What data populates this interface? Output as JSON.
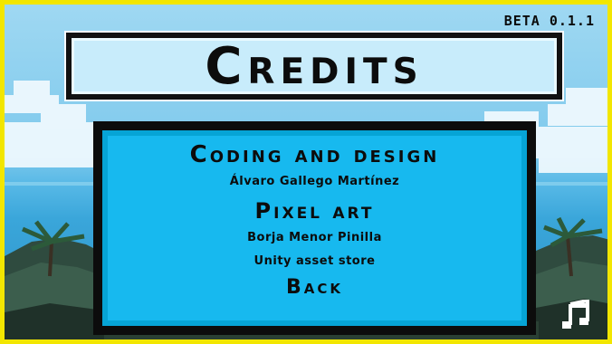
{
  "version": "BETA 0.1.1",
  "title": "Credits",
  "credits": {
    "section1_heading": "Coding and design",
    "section1_names": [
      "Álvaro Gallego Martínez"
    ],
    "section2_heading": "Pixel art",
    "section2_names": [
      "Borja Menor Pinilla",
      "Unity asset store"
    ]
  },
  "back_label": "Back",
  "icons": {
    "music": "music-note-icon"
  },
  "colors": {
    "border": "#f2e600",
    "panel": "#17b9ef",
    "panel_frame": "#0c0c0c",
    "title_box": "#c8ecfb"
  }
}
